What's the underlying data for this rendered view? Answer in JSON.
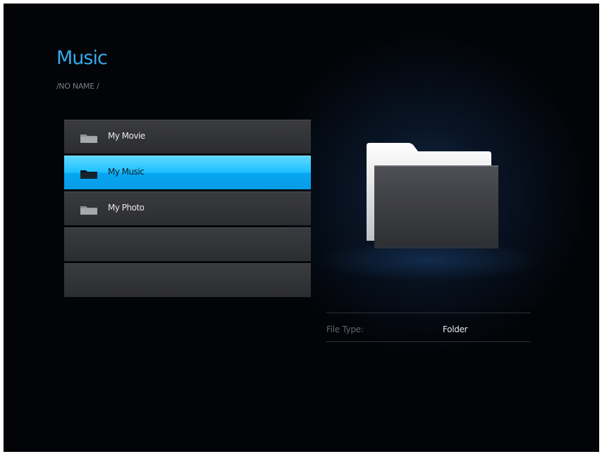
{
  "header": {
    "title": "Music",
    "breadcrumb": "/NO NAME  /"
  },
  "list": {
    "items": [
      {
        "label": "My Movie",
        "selected": false
      },
      {
        "label": "My Music",
        "selected": true
      },
      {
        "label": "My Photo",
        "selected": false
      },
      {
        "label": "",
        "selected": false
      },
      {
        "label": "",
        "selected": false
      }
    ]
  },
  "preview": {
    "icon": "folder-icon"
  },
  "info": {
    "file_type_label": "File Type:",
    "file_type_value": "Folder"
  },
  "colors": {
    "accent": "#35a8ea",
    "selection": "#1ec0ff",
    "background": "#020407"
  }
}
